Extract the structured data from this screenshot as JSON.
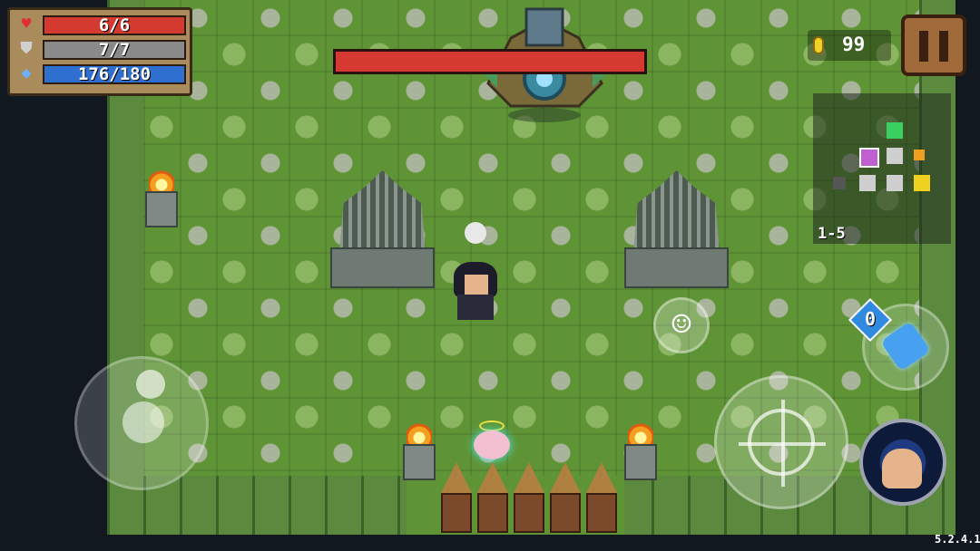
{
  "hud": {
    "hp": "6/6",
    "armor": "7/7",
    "energy": "176/180",
    "hp_icon": "heart-icon",
    "armor_icon": "shield-icon",
    "energy_icon": "diamond-icon"
  },
  "boss": {
    "health_fraction": 1.0,
    "bar_color": "#d43a30"
  },
  "coins": {
    "count": "99",
    "icon": "coin-icon"
  },
  "pause": {
    "icon": "pause-icon"
  },
  "minimap": {
    "level": "1-5"
  },
  "weapon": {
    "energy_cost": "0",
    "icon": "fist-weapon-icon"
  },
  "controls": {
    "emote_icon": "smiley-icon",
    "attack_icon": "crosshair-icon",
    "skill_icon": "hand-skill-icon",
    "emote_glyph": "☺"
  },
  "version": "5.2.4.1",
  "colors": {
    "hp": "#d43a30",
    "armor": "#8a8a8a",
    "energy": "#2f6fd0",
    "floor": "#5f9436"
  }
}
